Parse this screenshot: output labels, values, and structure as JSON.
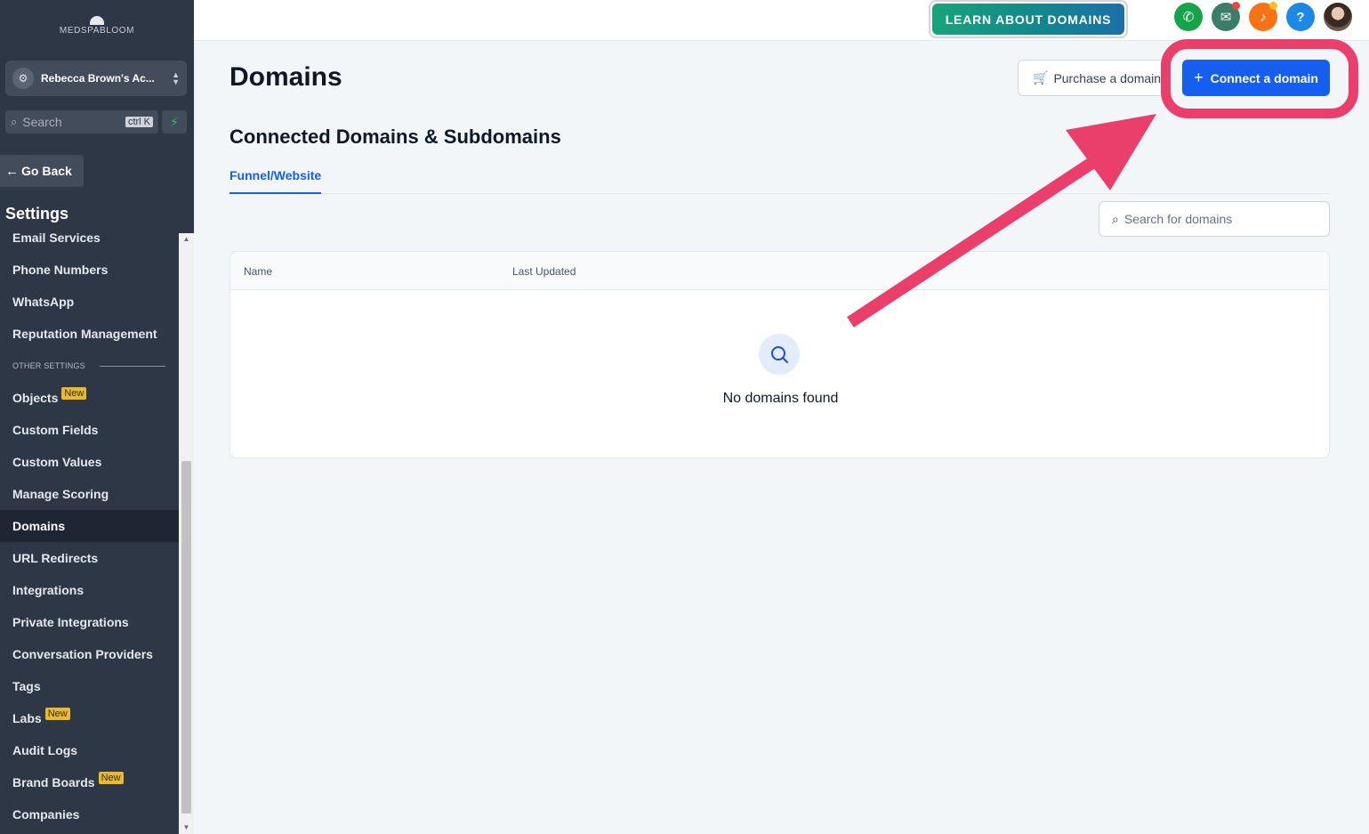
{
  "sidebar": {
    "logo_text": "MEDSPABLOOM",
    "account_name": "Rebecca Brown's Ac...",
    "search_label": "Search",
    "search_shortcut": "ctrl K",
    "go_back_label": "Go Back",
    "settings_title": "Settings",
    "items": [
      {
        "label": "Email Services"
      },
      {
        "label": "Phone Numbers"
      },
      {
        "label": "WhatsApp"
      },
      {
        "label": "Reputation Management"
      }
    ],
    "section_label": "OTHER SETTINGS",
    "other_items": [
      {
        "label": "Objects",
        "badge": "New"
      },
      {
        "label": "Custom Fields"
      },
      {
        "label": "Custom Values"
      },
      {
        "label": "Manage Scoring"
      },
      {
        "label": "Domains",
        "active": true
      },
      {
        "label": "URL Redirects"
      },
      {
        "label": "Integrations"
      },
      {
        "label": "Private Integrations"
      },
      {
        "label": "Conversation Providers"
      },
      {
        "label": "Tags"
      },
      {
        "label": "Labs",
        "badge": "New"
      },
      {
        "label": "Audit Logs"
      },
      {
        "label": "Brand Boards",
        "badge": "New"
      },
      {
        "label": "Companies"
      }
    ]
  },
  "topbar": {
    "learn_button": "LEARN ABOUT DOMAINS",
    "icons": [
      {
        "name": "phone-icon",
        "color": "#16a34a",
        "glyph": "✆"
      },
      {
        "name": "megaphone-icon",
        "color": "#3c7d69",
        "glyph": "📢"
      },
      {
        "name": "bell-icon",
        "color": "#f97316",
        "glyph": "🔔"
      },
      {
        "name": "help-icon",
        "color": "#1e88e5",
        "glyph": "?"
      }
    ]
  },
  "main": {
    "page_title": "Domains",
    "purchase_button": "Purchase a domain",
    "connect_button": "Connect a domain",
    "section_title": "Connected Domains & Subdomains",
    "tab_label": "Funnel/Website",
    "search_placeholder": "Search for domains",
    "table": {
      "columns": [
        "Name",
        "Last Updated"
      ],
      "empty_text": "No domains found"
    }
  },
  "colors": {
    "sidebar_bg": "#2e3746",
    "primary": "#155eef",
    "annotation": "#ea3e6b"
  }
}
